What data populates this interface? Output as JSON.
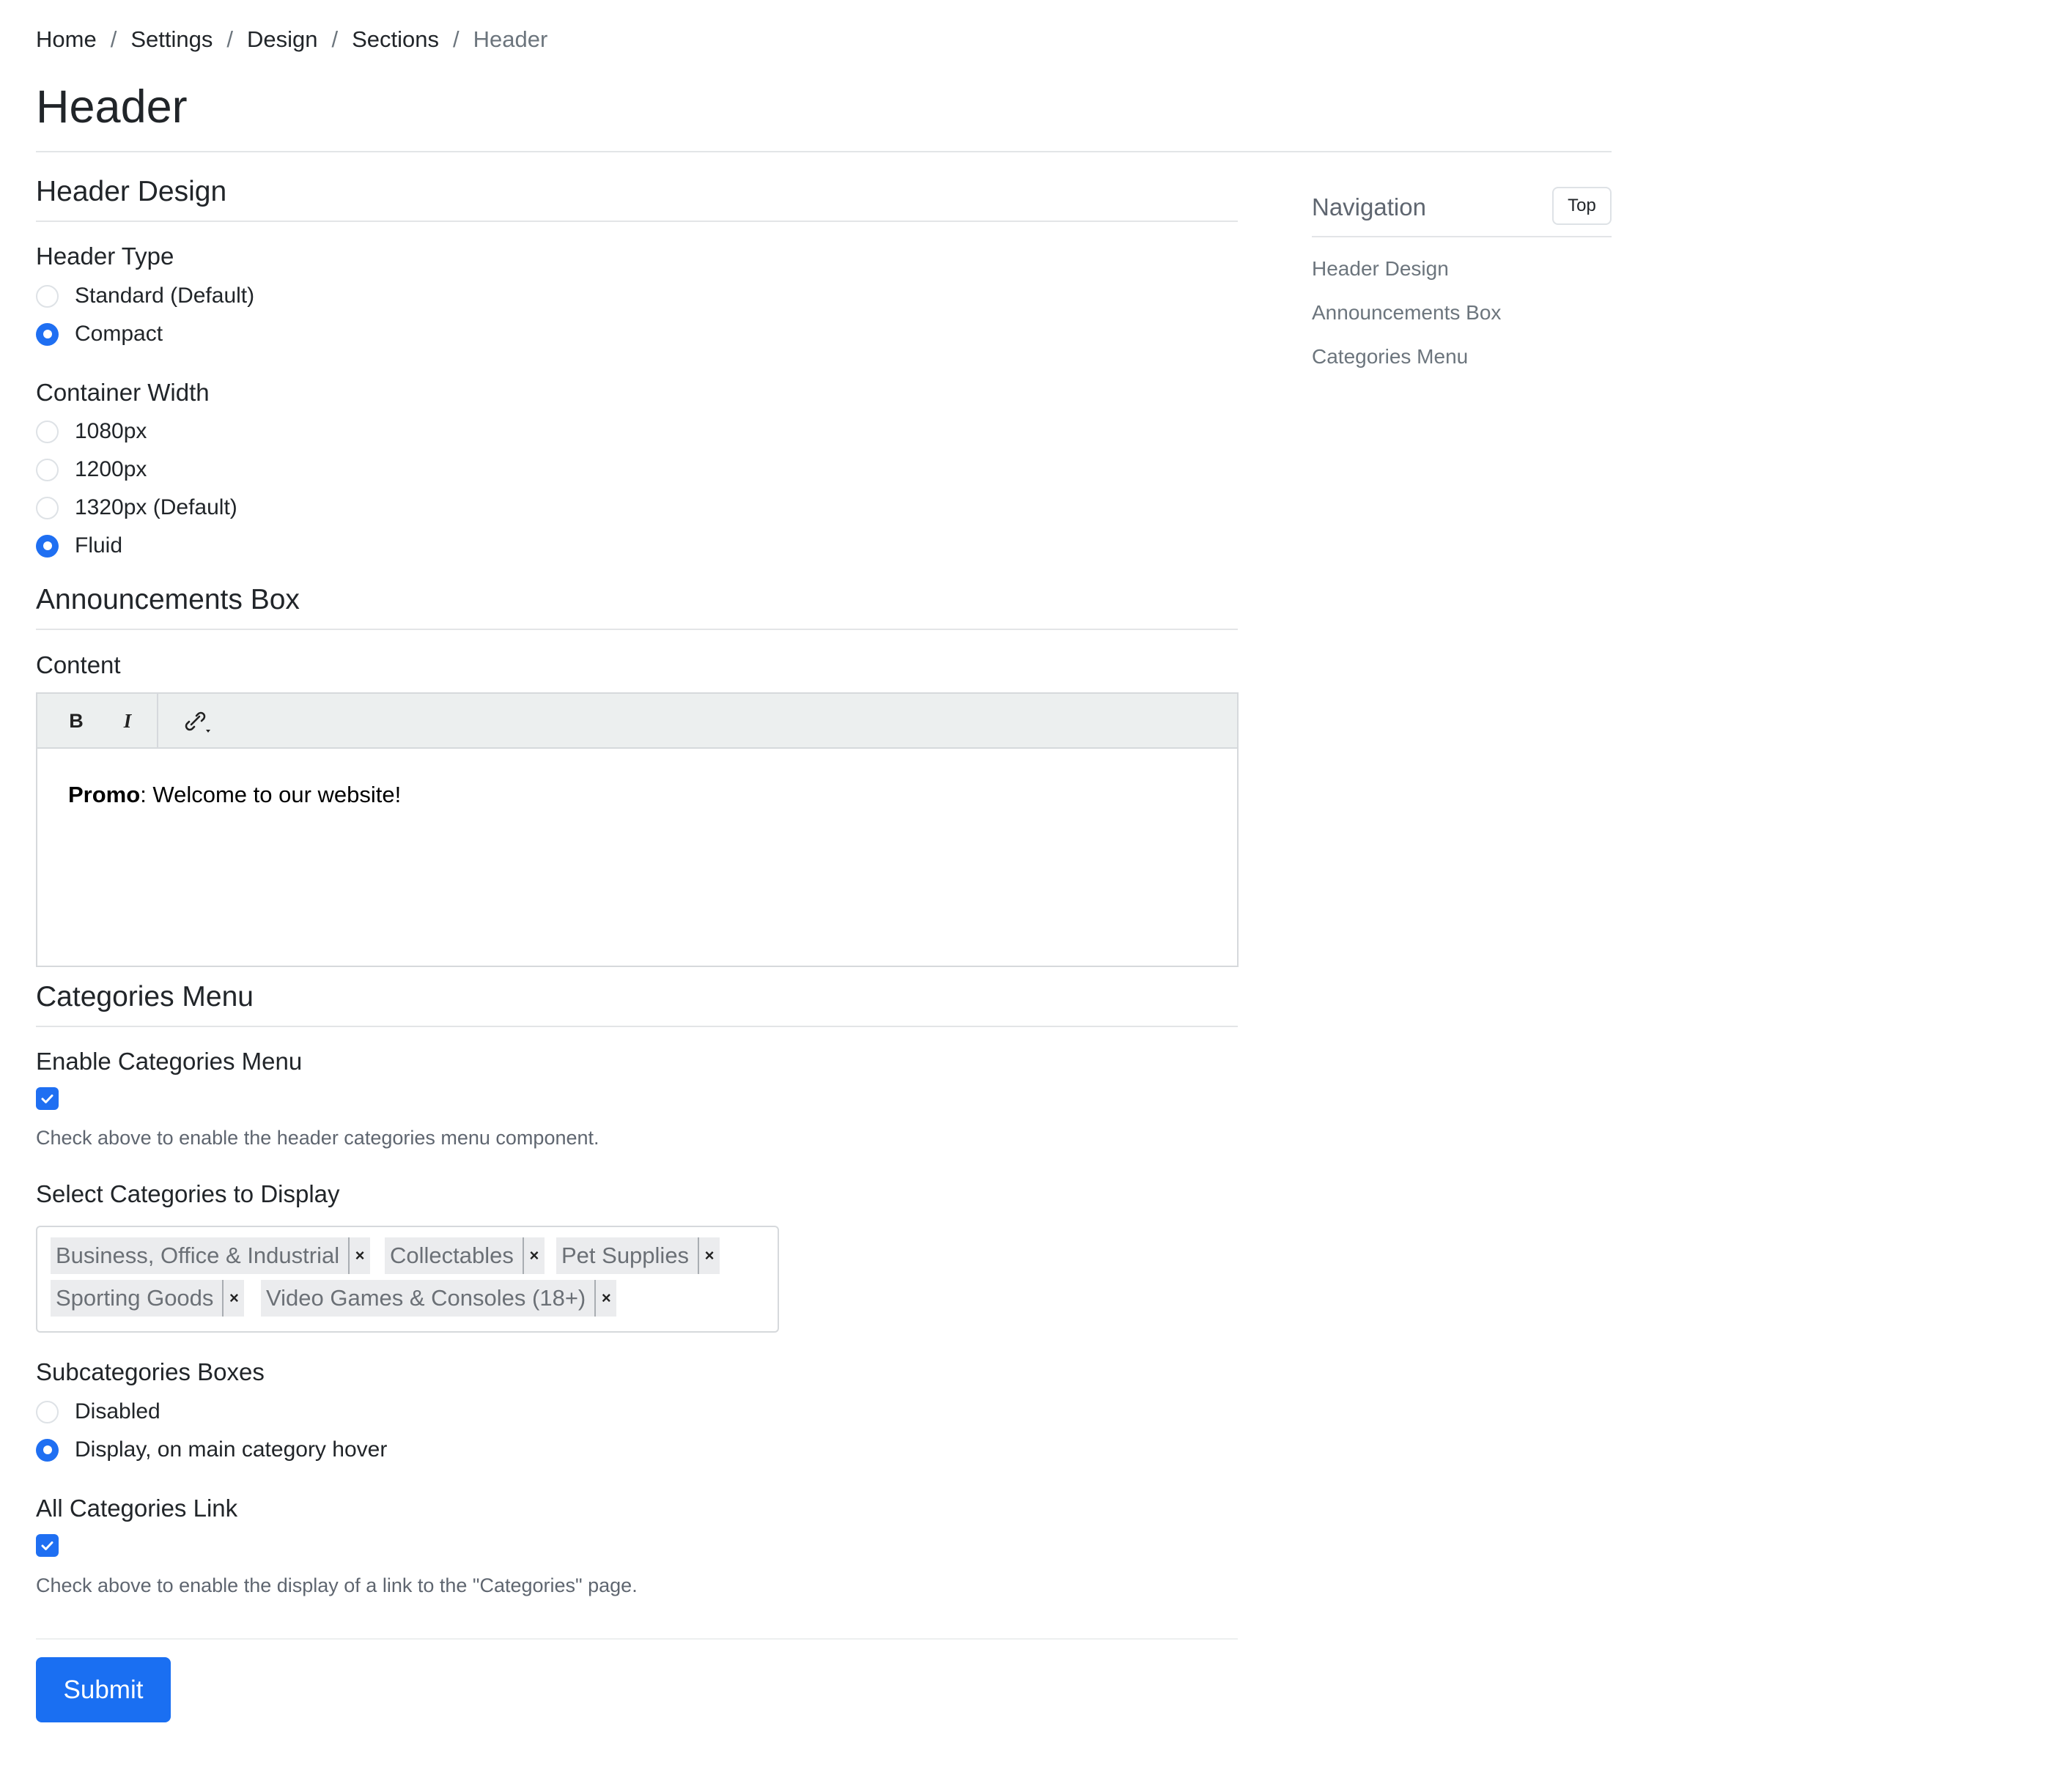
{
  "breadcrumb": {
    "items": [
      "Home",
      "Settings",
      "Design",
      "Sections"
    ],
    "current": "Header",
    "separator": "/"
  },
  "page": {
    "title": "Header"
  },
  "header_design": {
    "title": "Header Design",
    "header_type": {
      "label": "Header Type",
      "options": [
        "Standard (Default)",
        "Compact"
      ],
      "selected": "Compact"
    },
    "container_width": {
      "label": "Container Width",
      "options": [
        "1080px",
        "1200px",
        "1320px (Default)",
        "Fluid"
      ],
      "selected": "Fluid"
    }
  },
  "announcements": {
    "title": "Announcements Box",
    "content_label": "Content",
    "toolbar": {
      "bold": "B",
      "italic": "I"
    },
    "content_bold": "Promo",
    "content_rest": ": Welcome to our website!"
  },
  "categories_menu": {
    "title": "Categories Menu",
    "enable": {
      "label": "Enable Categories Menu",
      "checked": true,
      "help": "Check above to enable the header categories menu component."
    },
    "select": {
      "label": "Select Categories to Display",
      "tags": [
        "Business, Office & Industrial",
        "Collectables",
        "Pet Supplies",
        "Sporting Goods",
        "Video Games & Consoles (18+)"
      ],
      "remove_glyph": "×"
    },
    "subcategories": {
      "label": "Subcategories Boxes",
      "options": [
        "Disabled",
        "Display, on main category hover"
      ],
      "selected": "Display, on main category hover"
    },
    "all_link": {
      "label": "All Categories Link",
      "checked": true,
      "help": "Check above to enable the display of a link to the \"Categories\" page."
    }
  },
  "submit_label": "Submit",
  "navigation": {
    "title": "Navigation",
    "top_button": "Top",
    "links": [
      "Header Design",
      "Announcements Box",
      "Categories Menu"
    ]
  },
  "colors": {
    "accent": "#1f6ff2",
    "muted": "#6c757d"
  }
}
